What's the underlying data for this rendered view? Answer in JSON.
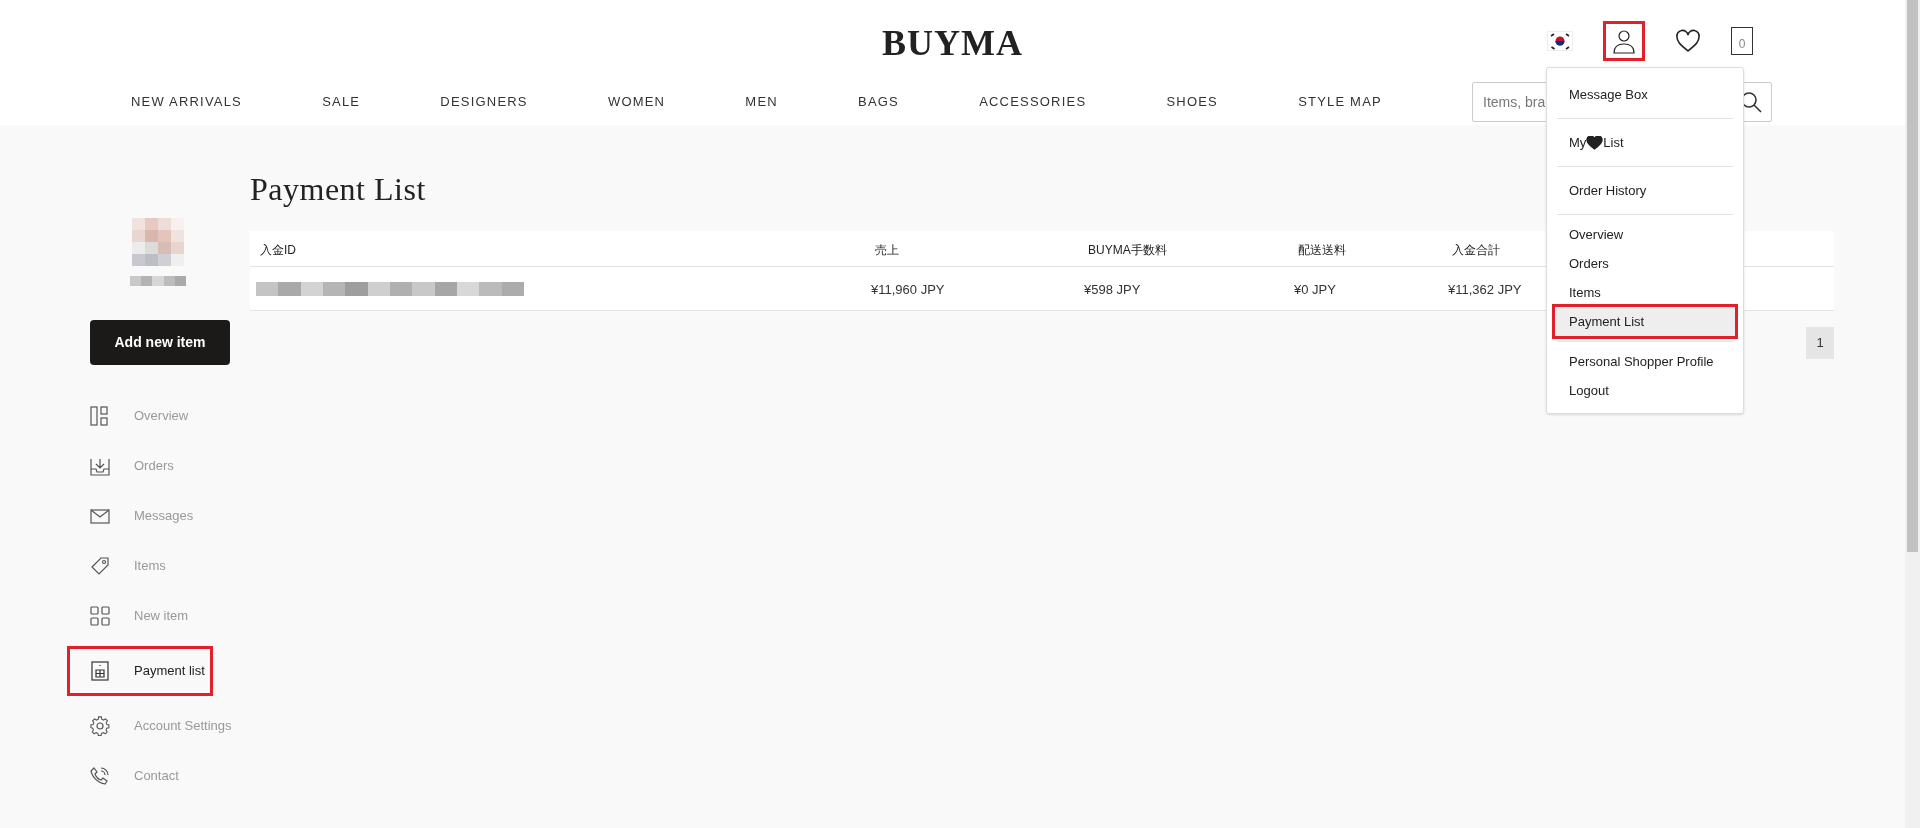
{
  "header": {
    "logo": "BUYMA",
    "cart_count": "0",
    "search": {
      "placeholder": "Items, bra"
    },
    "nav": [
      "NEW ARRIVALS",
      "SALE",
      "DESIGNERS",
      "WOMEN",
      "MEN",
      "BAGS",
      "ACCESSORIES",
      "SHOES",
      "STYLE MAP"
    ]
  },
  "account_menu": {
    "groups": [
      [
        {
          "label": "Message Box",
          "selected": false
        }
      ],
      [
        {
          "label": "My",
          "suffix": "List",
          "kind": "heart",
          "selected": false
        }
      ],
      [
        {
          "label": "Order History",
          "selected": false
        }
      ],
      [
        {
          "label": "Overview",
          "selected": false
        },
        {
          "label": "Orders",
          "selected": false
        },
        {
          "label": "Items",
          "selected": false
        },
        {
          "label": "Payment List",
          "selected": true
        }
      ],
      [
        {
          "label": "Personal Shopper Profile",
          "selected": false
        },
        {
          "label": "Logout",
          "selected": false
        }
      ]
    ]
  },
  "sidebar": {
    "add_button": "Add new item",
    "items": [
      {
        "label": "Overview",
        "kind": "overview",
        "selected": false
      },
      {
        "label": "Orders",
        "kind": "orders",
        "selected": false
      },
      {
        "label": "Messages",
        "kind": "messages",
        "selected": false
      },
      {
        "label": "Items",
        "kind": "items",
        "selected": false
      },
      {
        "label": "New item",
        "kind": "newitem",
        "selected": false
      },
      {
        "label": "Payment list",
        "kind": "payment",
        "selected": true
      },
      {
        "label": "Account Settings",
        "kind": "settings",
        "selected": false
      },
      {
        "label": "Contact",
        "kind": "contact",
        "selected": false
      }
    ]
  },
  "page": {
    "title": "Payment List",
    "table": {
      "columns": [
        "入金ID",
        "売上",
        "BUYMA手数料",
        "配送送料",
        "入金合計"
      ],
      "rows": [
        [
          "",
          "¥11,960 JPY",
          "¥598 JPY",
          "¥0 JPY",
          "¥11,362 JPY"
        ]
      ]
    },
    "pagination": [
      {
        "label": "1",
        "selected": true
      }
    ]
  }
}
